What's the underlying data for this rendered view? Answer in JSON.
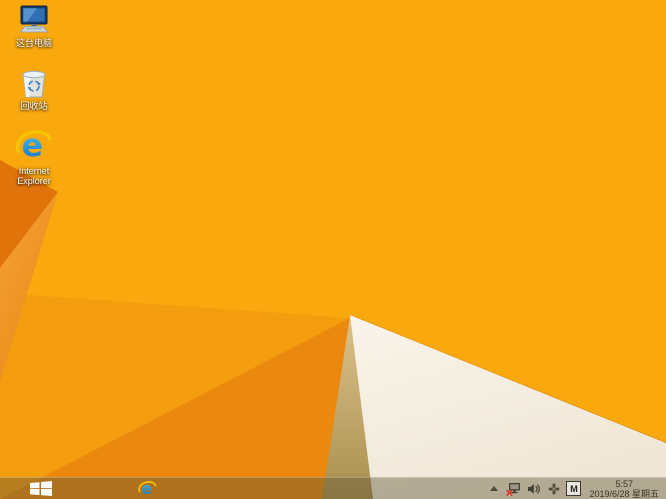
{
  "desktop": {
    "icons": [
      {
        "name": "this-pc",
        "label": "这台电脑"
      },
      {
        "name": "recycle-bin",
        "label": "回收站"
      },
      {
        "name": "internet-explorer",
        "label": "Internet Explorer"
      }
    ]
  },
  "taskbar": {
    "start_button": "start",
    "pinned": [
      {
        "name": "internet-explorer"
      }
    ],
    "tray": {
      "hidden_icons_chevron": "show-hidden-icons",
      "icons": [
        "network-disconnected",
        "volume",
        "vm-tools-cross",
        "input-method"
      ],
      "input_indicator": "M",
      "clock": {
        "time": "5:57",
        "date": "2019/6/28 星期五"
      }
    }
  },
  "colors": {
    "wallpaper_base": "#F9A80D",
    "wallpaper_facet_mid": "#F49D0E",
    "wallpaper_facet_dark": "#EB890E",
    "wallpaper_wedge_dark": "#E1730B",
    "wallpaper_shadow_khaki": "#AC9251",
    "wallpaper_cream": "#F3EDE0",
    "taskbar_tint": "rgba(92,84,52,0.42)",
    "ie_blue": "#1173C8",
    "ie_gold": "#F7C700",
    "tray_alert_red": "#D93A2B"
  }
}
